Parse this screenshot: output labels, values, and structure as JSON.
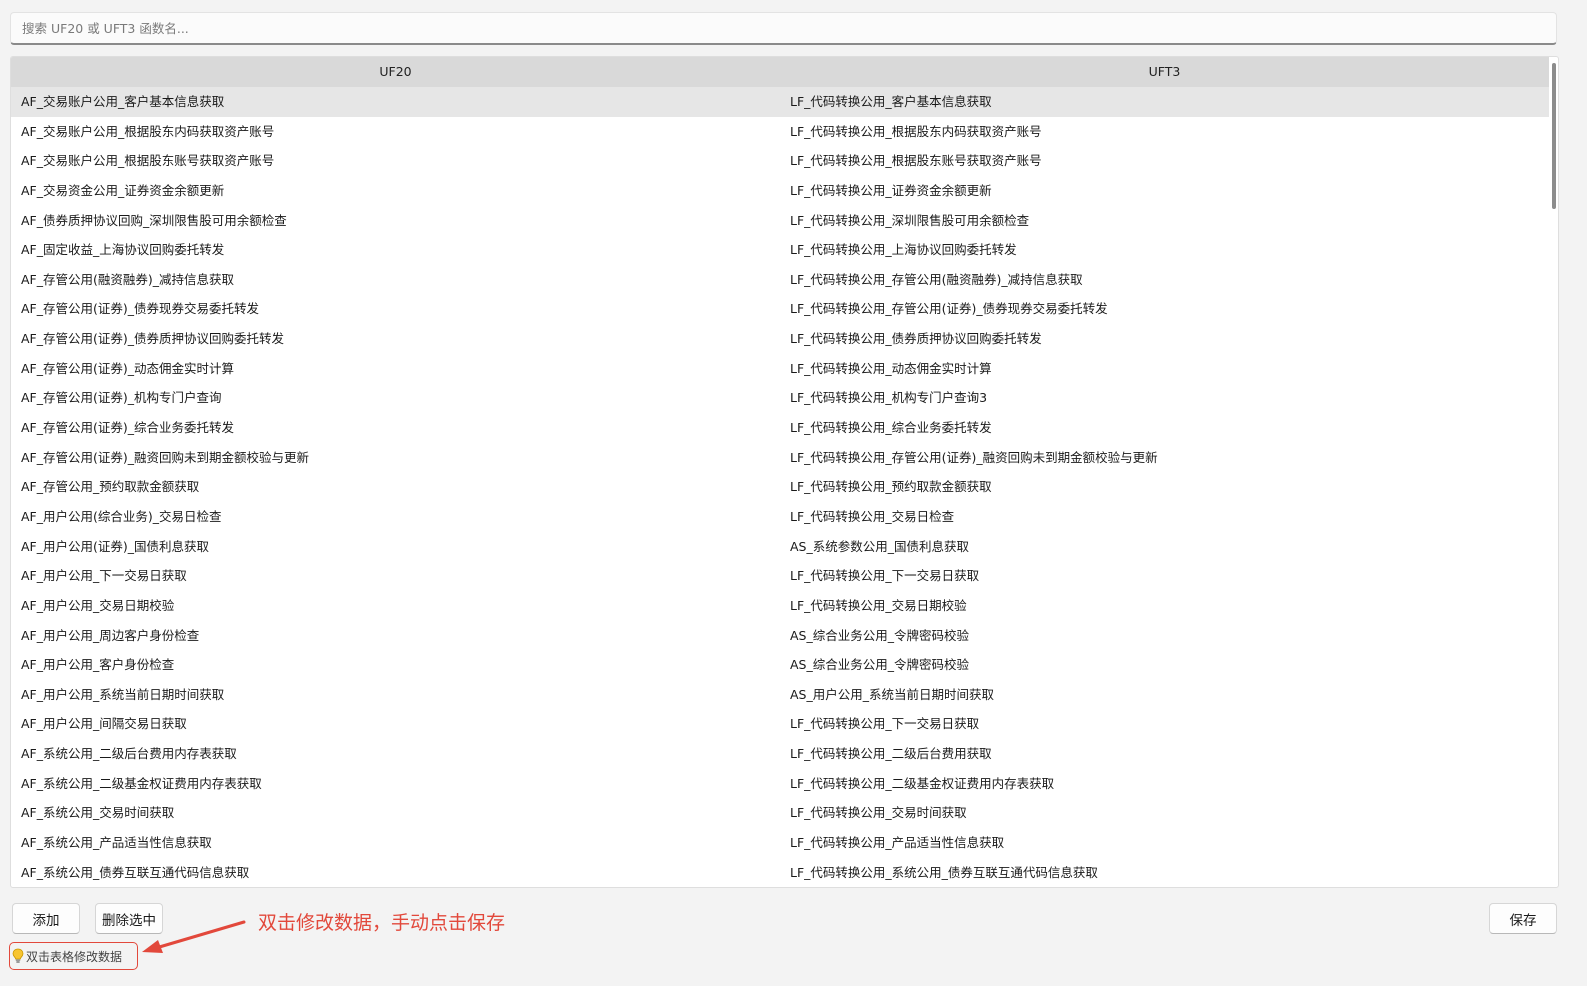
{
  "search": {
    "placeholder": "搜索 UF20 或 UFT3 函数名..."
  },
  "table": {
    "columns": [
      "UF20",
      "UFT3"
    ],
    "selected_row": 0,
    "scroll_position": 0.0,
    "rows": [
      [
        "AF_交易账户公用_客户基本信息获取",
        "LF_代码转换公用_客户基本信息获取"
      ],
      [
        "AF_交易账户公用_根据股东内码获取资产账号",
        "LF_代码转换公用_根据股东内码获取资产账号"
      ],
      [
        "AF_交易账户公用_根据股东账号获取资产账号",
        "LF_代码转换公用_根据股东账号获取资产账号"
      ],
      [
        "AF_交易资金公用_证券资金余额更新",
        "LF_代码转换公用_证券资金余额更新"
      ],
      [
        "AF_债券质押协议回购_深圳限售股可用余额检查",
        "LF_代码转换公用_深圳限售股可用余额检查"
      ],
      [
        "AF_固定收益_上海协议回购委托转发",
        "LF_代码转换公用_上海协议回购委托转发"
      ],
      [
        "AF_存管公用(融资融券)_减持信息获取",
        "LF_代码转换公用_存管公用(融资融券)_减持信息获取"
      ],
      [
        "AF_存管公用(证券)_债券现券交易委托转发",
        "LF_代码转换公用_存管公用(证券)_债券现券交易委托转发"
      ],
      [
        "AF_存管公用(证券)_债券质押协议回购委托转发",
        "LF_代码转换公用_债券质押协议回购委托转发"
      ],
      [
        "AF_存管公用(证券)_动态佣金实时计算",
        "LF_代码转换公用_动态佣金实时计算"
      ],
      [
        "AF_存管公用(证券)_机构专门户查询",
        "LF_代码转换公用_机构专门户查询3"
      ],
      [
        "AF_存管公用(证券)_综合业务委托转发",
        "LF_代码转换公用_综合业务委托转发"
      ],
      [
        "AF_存管公用(证券)_融资回购未到期金额校验与更新",
        "LF_代码转换公用_存管公用(证券)_融资回购未到期金额校验与更新"
      ],
      [
        "AF_存管公用_预约取款金额获取",
        "LF_代码转换公用_预约取款金额获取"
      ],
      [
        "AF_用户公用(综合业务)_交易日检查",
        "LF_代码转换公用_交易日检查"
      ],
      [
        "AF_用户公用(证券)_国债利息获取",
        "AS_系统参数公用_国债利息获取"
      ],
      [
        "AF_用户公用_下一交易日获取",
        "LF_代码转换公用_下一交易日获取"
      ],
      [
        "AF_用户公用_交易日期校验",
        "LF_代码转换公用_交易日期校验"
      ],
      [
        "AF_用户公用_周边客户身份检查",
        "AS_综合业务公用_令牌密码校验"
      ],
      [
        "AF_用户公用_客户身份检查",
        "AS_综合业务公用_令牌密码校验"
      ],
      [
        "AF_用户公用_系统当前日期时间获取",
        "AS_用户公用_系统当前日期时间获取"
      ],
      [
        "AF_用户公用_间隔交易日获取",
        "LF_代码转换公用_下一交易日获取"
      ],
      [
        "AF_系统公用_二级后台费用内存表获取",
        "LF_代码转换公用_二级后台费用获取"
      ],
      [
        "AF_系统公用_二级基金权证费用内存表获取",
        "LF_代码转换公用_二级基金权证费用内存表获取"
      ],
      [
        "AF_系统公用_交易时间获取",
        "LF_代码转换公用_交易时间获取"
      ],
      [
        "AF_系统公用_产品适当性信息获取",
        "LF_代码转换公用_产品适当性信息获取"
      ],
      [
        "AF_系统公用_债券互联互通代码信息获取",
        "LF_代码转换公用_系统公用_债券互联互通代码信息获取"
      ]
    ]
  },
  "buttons": {
    "add": "添加",
    "delete": "删除选中",
    "save": "保存"
  },
  "hint": {
    "text": "双击表格修改数据",
    "icon": "lightbulb-icon"
  },
  "annotation": {
    "text": "双击修改数据，手动点击保存",
    "color": "#e2483b"
  }
}
